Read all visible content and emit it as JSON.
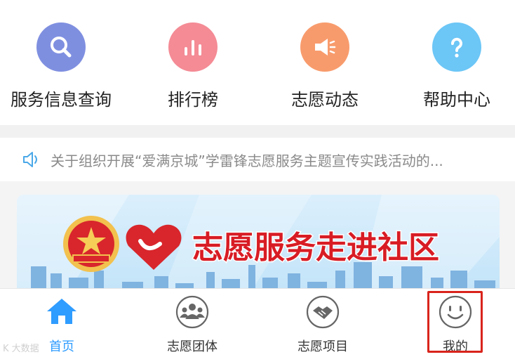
{
  "quick_actions": [
    {
      "label": "服务信息查询",
      "icon": "search-icon",
      "color": "#7f8fe0"
    },
    {
      "label": "排行榜",
      "icon": "bar-chart-icon",
      "color": "#f48b95"
    },
    {
      "label": "志愿动态",
      "icon": "megaphone-icon",
      "color": "#f89b6c"
    },
    {
      "label": "帮助中心",
      "icon": "question-icon",
      "color": "#6cc6f6"
    }
  ],
  "notice": {
    "icon": "speaker-icon",
    "text": "关于组织开展“爱满京城”学雷锋志愿服务主题宣传实践活动的..."
  },
  "banner": {
    "title": "志愿服务走进社区",
    "emblem": "youth-league-emblem",
    "logo": "heart-hand-logo"
  },
  "nav": {
    "items": [
      {
        "label": "首页",
        "icon": "home-icon",
        "active": true
      },
      {
        "label": "志愿团体",
        "icon": "group-icon",
        "active": false
      },
      {
        "label": "志愿项目",
        "icon": "handshake-icon",
        "active": false
      },
      {
        "label": "我的",
        "icon": "smiley-icon",
        "active": false
      }
    ]
  },
  "watermark": "K 大数据",
  "colors": {
    "accent": "#2f9cff",
    "highlight": "#d9241c",
    "banner_text": "#d81c24"
  }
}
